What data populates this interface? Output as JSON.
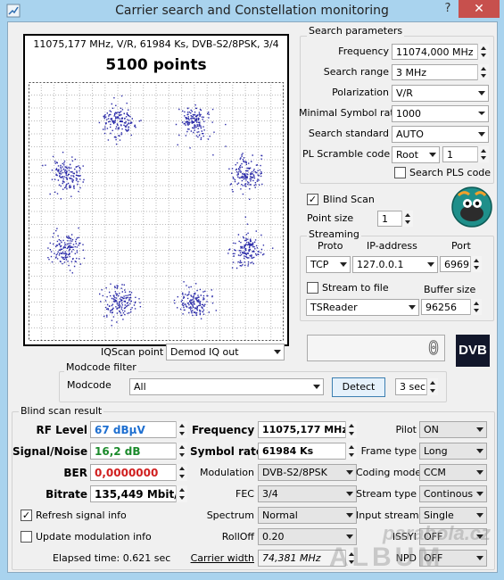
{
  "window": {
    "title": "Carrier search and Constellation monitoring",
    "help_glyph": "?",
    "close_glyph": "✕"
  },
  "plot": {
    "header": "11075,177 MHz, V/R, 61984 Ks, DVB-S2/8PSK, 3/4",
    "points_label": "5100 points"
  },
  "search_params": {
    "group_title": "Search parameters",
    "frequency_label": "Frequency",
    "frequency_value": "11074,000 MHz",
    "search_range_label": "Search range",
    "search_range_value": "3 MHz",
    "polarization_label": "Polarization",
    "polarization_value": "V/R",
    "min_symbol_rate_label": "Minimal Symbol rate",
    "min_symbol_rate_value": "1000",
    "search_standard_label": "Search standard",
    "search_standard_value": "AUTO",
    "pl_scramble_label": "PL Scramble code",
    "pl_scramble_value": "Root",
    "pl_scramble_num": "1",
    "search_pls_label": "Search PLS code",
    "search_pls_checked": false
  },
  "blind_scan": {
    "label": "Blind Scan",
    "checked": true,
    "point_size_label": "Point size",
    "point_size_value": "1"
  },
  "streaming": {
    "group_title": "Streaming",
    "proto_header": "Proto",
    "ip_header": "IP-address",
    "port_header": "Port",
    "proto_value": "TCP",
    "ip_value": "127.0.0.1",
    "port_value": "6969",
    "stream_to_file_label": "Stream to file",
    "stream_to_file_checked": false,
    "buffer_size_label": "Buffer size",
    "target_value": "TSReader",
    "buffer_size_value": "96256"
  },
  "iqscan": {
    "label": "IQScan point",
    "value": "Demod IQ out"
  },
  "counter_display": "0",
  "dvb_logo": "DVB",
  "modcode_filter": {
    "group_title": "Modcode filter",
    "label": "Modcode",
    "value": "All",
    "detect_label": "Detect",
    "interval_value": "3 sec"
  },
  "results": {
    "group_title": "Blind scan result",
    "rf_level_label": "RF Level",
    "rf_level_value": "67 dBµV",
    "snr_label": "Signal/Noise",
    "snr_value": "16,2 dB",
    "ber_label": "BER",
    "ber_value": "0,0000000",
    "bitrate_label": "Bitrate",
    "bitrate_value": "135,449 Mbit/s",
    "refresh_label": "Refresh signal info",
    "refresh_checked": true,
    "update_mod_label": "Update modulation info",
    "update_mod_checked": false,
    "elapsed_label": "Elapsed time: 0.621 sec",
    "frequency_label": "Frequency",
    "frequency_value": "11075,177 MHz",
    "symbol_rate_label": "Symbol rate",
    "symbol_rate_value": "61984 Ks",
    "modulation_label": "Modulation",
    "modulation_value": "DVB-S2/8PSK",
    "fec_label": "FEC",
    "fec_value": "3/4",
    "spectrum_label": "Spectrum",
    "spectrum_value": "Normal",
    "rolloff_label": "RollOff",
    "rolloff_value": "0.20",
    "carrier_width_label": "Carrier width",
    "carrier_width_value": "74,381 MHz",
    "pilot_label": "Pilot",
    "pilot_value": "ON",
    "frame_type_label": "Frame type",
    "frame_type_value": "Long",
    "coding_mode_label": "Coding mode",
    "coding_mode_value": "CCM",
    "stream_type_label": "Stream type",
    "stream_type_value": "Continous",
    "input_stream_label": "Input stream",
    "input_stream_value": "Single",
    "issyi_label": "ISSYI",
    "issyi_value": "OFF",
    "npd_label": "NPD",
    "npd_value": "OFF"
  },
  "watermark": {
    "line1": "parabola.cz",
    "line2": "ALBUM"
  },
  "colors": {
    "rf_level": "#1e6fd0",
    "snr": "#1b8a2b",
    "ber": "#d01f1f",
    "dots": "#2a2aa8",
    "close": "#c7504d"
  },
  "constellation": {
    "type": "8PSK",
    "clusters": 8,
    "points": 5100
  }
}
